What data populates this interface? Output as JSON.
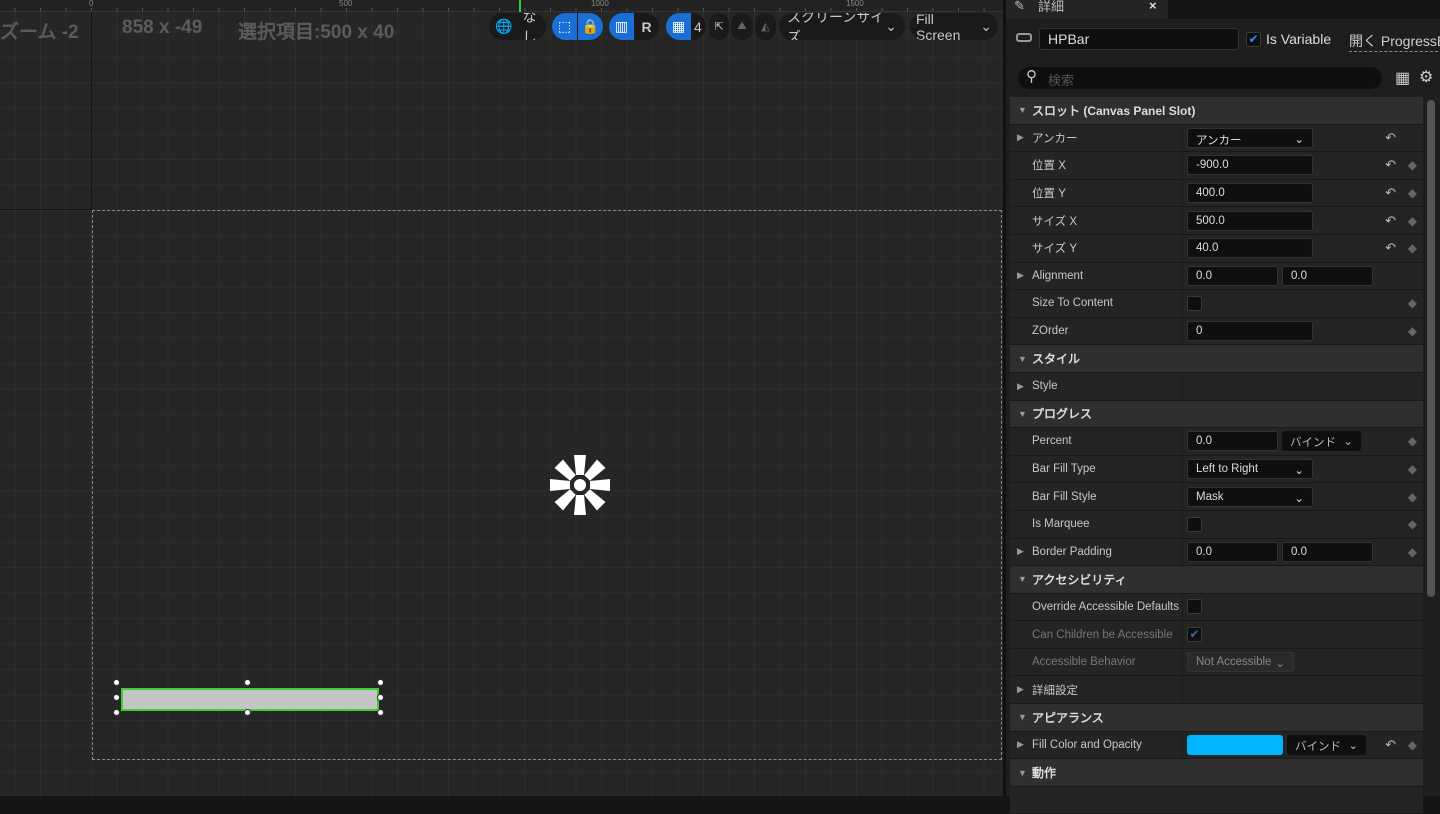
{
  "canvas": {
    "ruler_labels": [
      "0",
      "500",
      "1000",
      "1500"
    ],
    "zoom": "ズーム -2",
    "cursor": "858 x -49",
    "selection": "選択項目:500 x 40"
  },
  "toolbar": {
    "none_label": "なし",
    "r_label": "R",
    "grid_count": "4",
    "screen_size": "スクリーンサイズ",
    "fill_screen": "Fill Screen"
  },
  "panel": {
    "tab_title": "詳細",
    "widget_name": "HPBar",
    "is_variable_label": "Is Variable",
    "is_variable": true,
    "open_link": "開く ProgressBar",
    "search_placeholder": "検索",
    "rows": [
      {
        "type": "section",
        "label": "スロット (Canvas Panel Slot)"
      },
      {
        "label": "アンカー",
        "expand": true,
        "dropdown": "アンカー",
        "reset": true
      },
      {
        "label": "位置 X",
        "input": "-900.0",
        "reset": true,
        "key": true
      },
      {
        "label": "位置 Y",
        "input": "400.0",
        "reset": true,
        "key": true
      },
      {
        "label": "サイズ X",
        "input": "500.0",
        "reset": true,
        "key": true
      },
      {
        "label": "サイズ Y",
        "input": "40.0",
        "reset": true,
        "key": true
      },
      {
        "label": "Alignment",
        "expand": true,
        "pair": [
          "0.0",
          "0.0"
        ]
      },
      {
        "label": "Size To Content",
        "check": false,
        "key": true
      },
      {
        "label": "ZOrder",
        "input": "0",
        "key": true
      },
      {
        "type": "section",
        "label": "スタイル"
      },
      {
        "label": "Style",
        "expand": true
      },
      {
        "type": "section",
        "label": "プログレス"
      },
      {
        "label": "Percent",
        "half": "0.0",
        "bind": "バインド",
        "key": true
      },
      {
        "label": "Bar Fill Type",
        "dropdown": "Left to Right",
        "key": true
      },
      {
        "label": "Bar Fill Style",
        "dropdown": "Mask",
        "key": true
      },
      {
        "label": "Is Marquee",
        "check": false,
        "key": true
      },
      {
        "label": "Border Padding",
        "expand": true,
        "pair": [
          "0.0",
          "0.0"
        ],
        "key": true
      },
      {
        "type": "section",
        "label": "アクセシビリティ"
      },
      {
        "label": "Override Accessible Defaults",
        "check": false
      },
      {
        "label": "Can Children be Accessible",
        "check": true,
        "disabled": true
      },
      {
        "label": "Accessible Behavior",
        "dropdown": "Not Accessible",
        "disabled": true
      },
      {
        "label": "詳細設定",
        "expand": true
      },
      {
        "type": "section",
        "label": "アピアランス"
      },
      {
        "label": "Fill Color and Opacity",
        "expand": true,
        "color": "#00b4ff",
        "bind": "バインド",
        "reset": true,
        "key": true
      },
      {
        "type": "section",
        "label": "動作"
      }
    ]
  }
}
